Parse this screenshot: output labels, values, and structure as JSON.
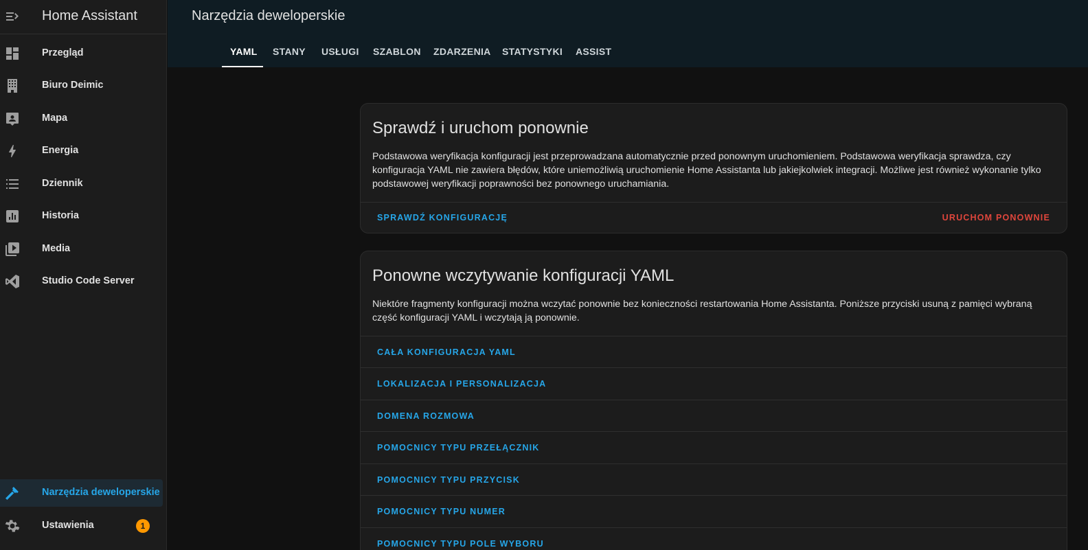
{
  "app": {
    "title": "Home Assistant"
  },
  "sidebar": {
    "items": [
      {
        "label": "Przegląd",
        "icon": "dashboard-icon"
      },
      {
        "label": "Biuro Deimic",
        "icon": "building-icon"
      },
      {
        "label": "Mapa",
        "icon": "map-account-icon"
      },
      {
        "label": "Energia",
        "icon": "lightning-icon"
      },
      {
        "label": "Dziennik",
        "icon": "logbook-icon"
      },
      {
        "label": "Historia",
        "icon": "chart-box-icon"
      },
      {
        "label": "Media",
        "icon": "play-box-icon"
      },
      {
        "label": "Studio Code Server",
        "icon": "vscode-icon"
      }
    ],
    "developer_tools": "Narzędzia deweloperskie",
    "settings": "Ustawienia",
    "settings_badge": "1"
  },
  "header": {
    "title": "Narzędzia deweloperskie",
    "tabs": [
      "YAML",
      "STANY",
      "USŁUGI",
      "SZABLON",
      "ZDARZENIA",
      "STATYSTYKI",
      "ASSIST"
    ],
    "active_tab": "YAML"
  },
  "check_card": {
    "title": "Sprawdź i uruchom ponownie",
    "text": "Podstawowa weryfikacja konfiguracji jest przeprowadzana automatycznie przed ponownym uruchomieniem. Podstawowa weryfikacja sprawdza, czy konfiguracja YAML nie zawiera błędów, które uniemożliwią uruchomienie Home Assistanta lub jakiejkolwiek integracji. Możliwe jest również wykonanie tylko podstawowej weryfikacji poprawności bez ponownego uruchamiania.",
    "check_button": "SPRAWDŹ KONFIGURACJĘ",
    "restart_button": "URUCHOM PONOWNIE"
  },
  "reload_card": {
    "title": "Ponowne wczytywanie konfiguracji YAML",
    "text": "Niektóre fragmenty konfiguracji można wczytać ponownie bez konieczności restartowania Home Assistanta. Poniższe przyciski usuną z pamięci wybraną część konfiguracji YAML i wczytają ją ponownie.",
    "items": [
      "CAŁA KONFIGURACJA YAML",
      "LOKALIZACJA I PERSONALIZACJA",
      "DOMENA ROZMOWA",
      "POMOCNICY TYPU PRZEŁĄCZNIK",
      "POMOCNICY TYPU PRZYCISK",
      "POMOCNICY TYPU NUMER",
      "POMOCNICY TYPU POLE WYBORU"
    ]
  },
  "colors": {
    "accent": "#26a6e8",
    "danger": "#e0463c",
    "badge": "#ff9800",
    "header_bg": "#0f1c23",
    "sidebar_bg": "#1c1c1c"
  }
}
